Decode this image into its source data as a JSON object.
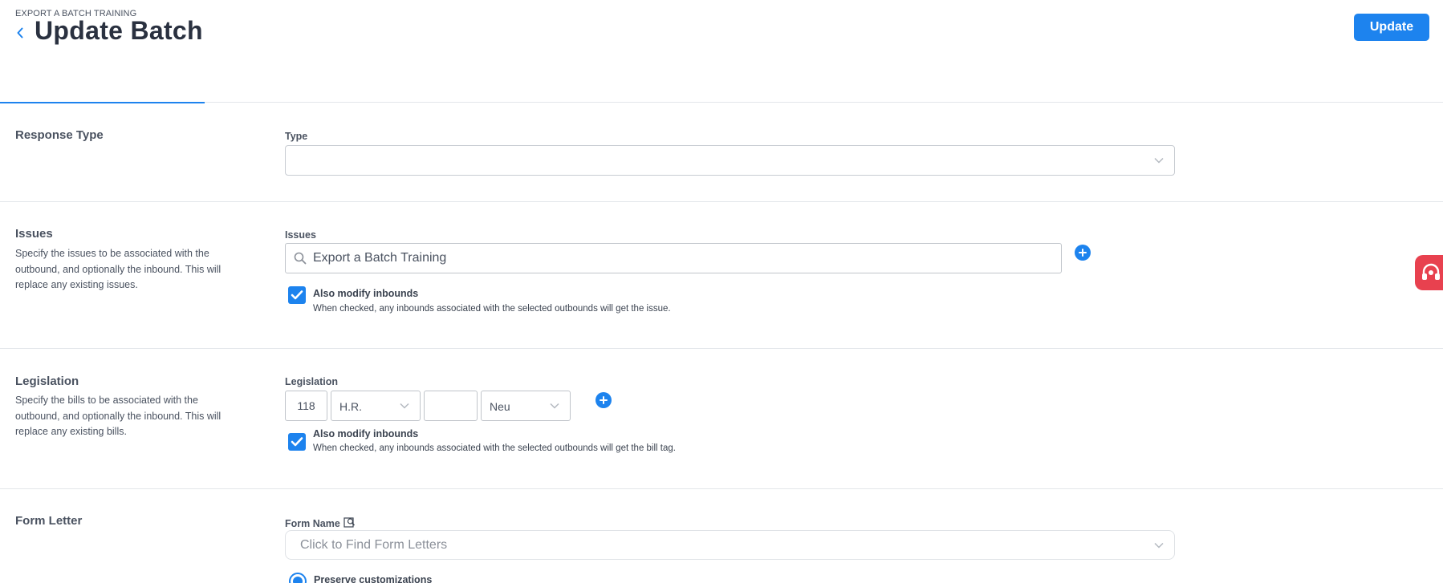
{
  "header": {
    "breadcrumb": "EXPORT A BATCH TRAINING",
    "title": "Update Batch",
    "update_label": "Update"
  },
  "response_type": {
    "title": "Response Type",
    "type_label": "Type",
    "type_value": ""
  },
  "issues": {
    "title": "Issues",
    "description": "Specify the issues to be associated with the outbound, and optionally the inbound. This will replace any existing issues.",
    "field_label": "Issues",
    "search_value": "Export a Batch Training",
    "also_modify_label": "Also modify inbounds",
    "also_modify_help": "When checked, any inbounds associated with the selected outbounds will get the issue.",
    "also_modify_checked": true
  },
  "legislation": {
    "title": "Legislation",
    "description": "Specify the bills to be associated with the outbound, and optionally the inbound. This will replace any existing bills.",
    "field_label": "Legislation",
    "congress": "118",
    "bill_type": "H.R.",
    "bill_number": "",
    "stance": "Neu",
    "also_modify_label": "Also modify inbounds",
    "also_modify_help": "When checked, any inbounds associated with the selected outbounds will get the bill tag.",
    "also_modify_checked": true
  },
  "form_letter": {
    "title": "Form Letter",
    "form_name_label": "Form Name",
    "form_name_placeholder": "Click to Find Form Letters",
    "preserve_label": "Preserve customizations"
  },
  "colors": {
    "accent": "#1d83ee",
    "side_tab": "#e8414f"
  }
}
